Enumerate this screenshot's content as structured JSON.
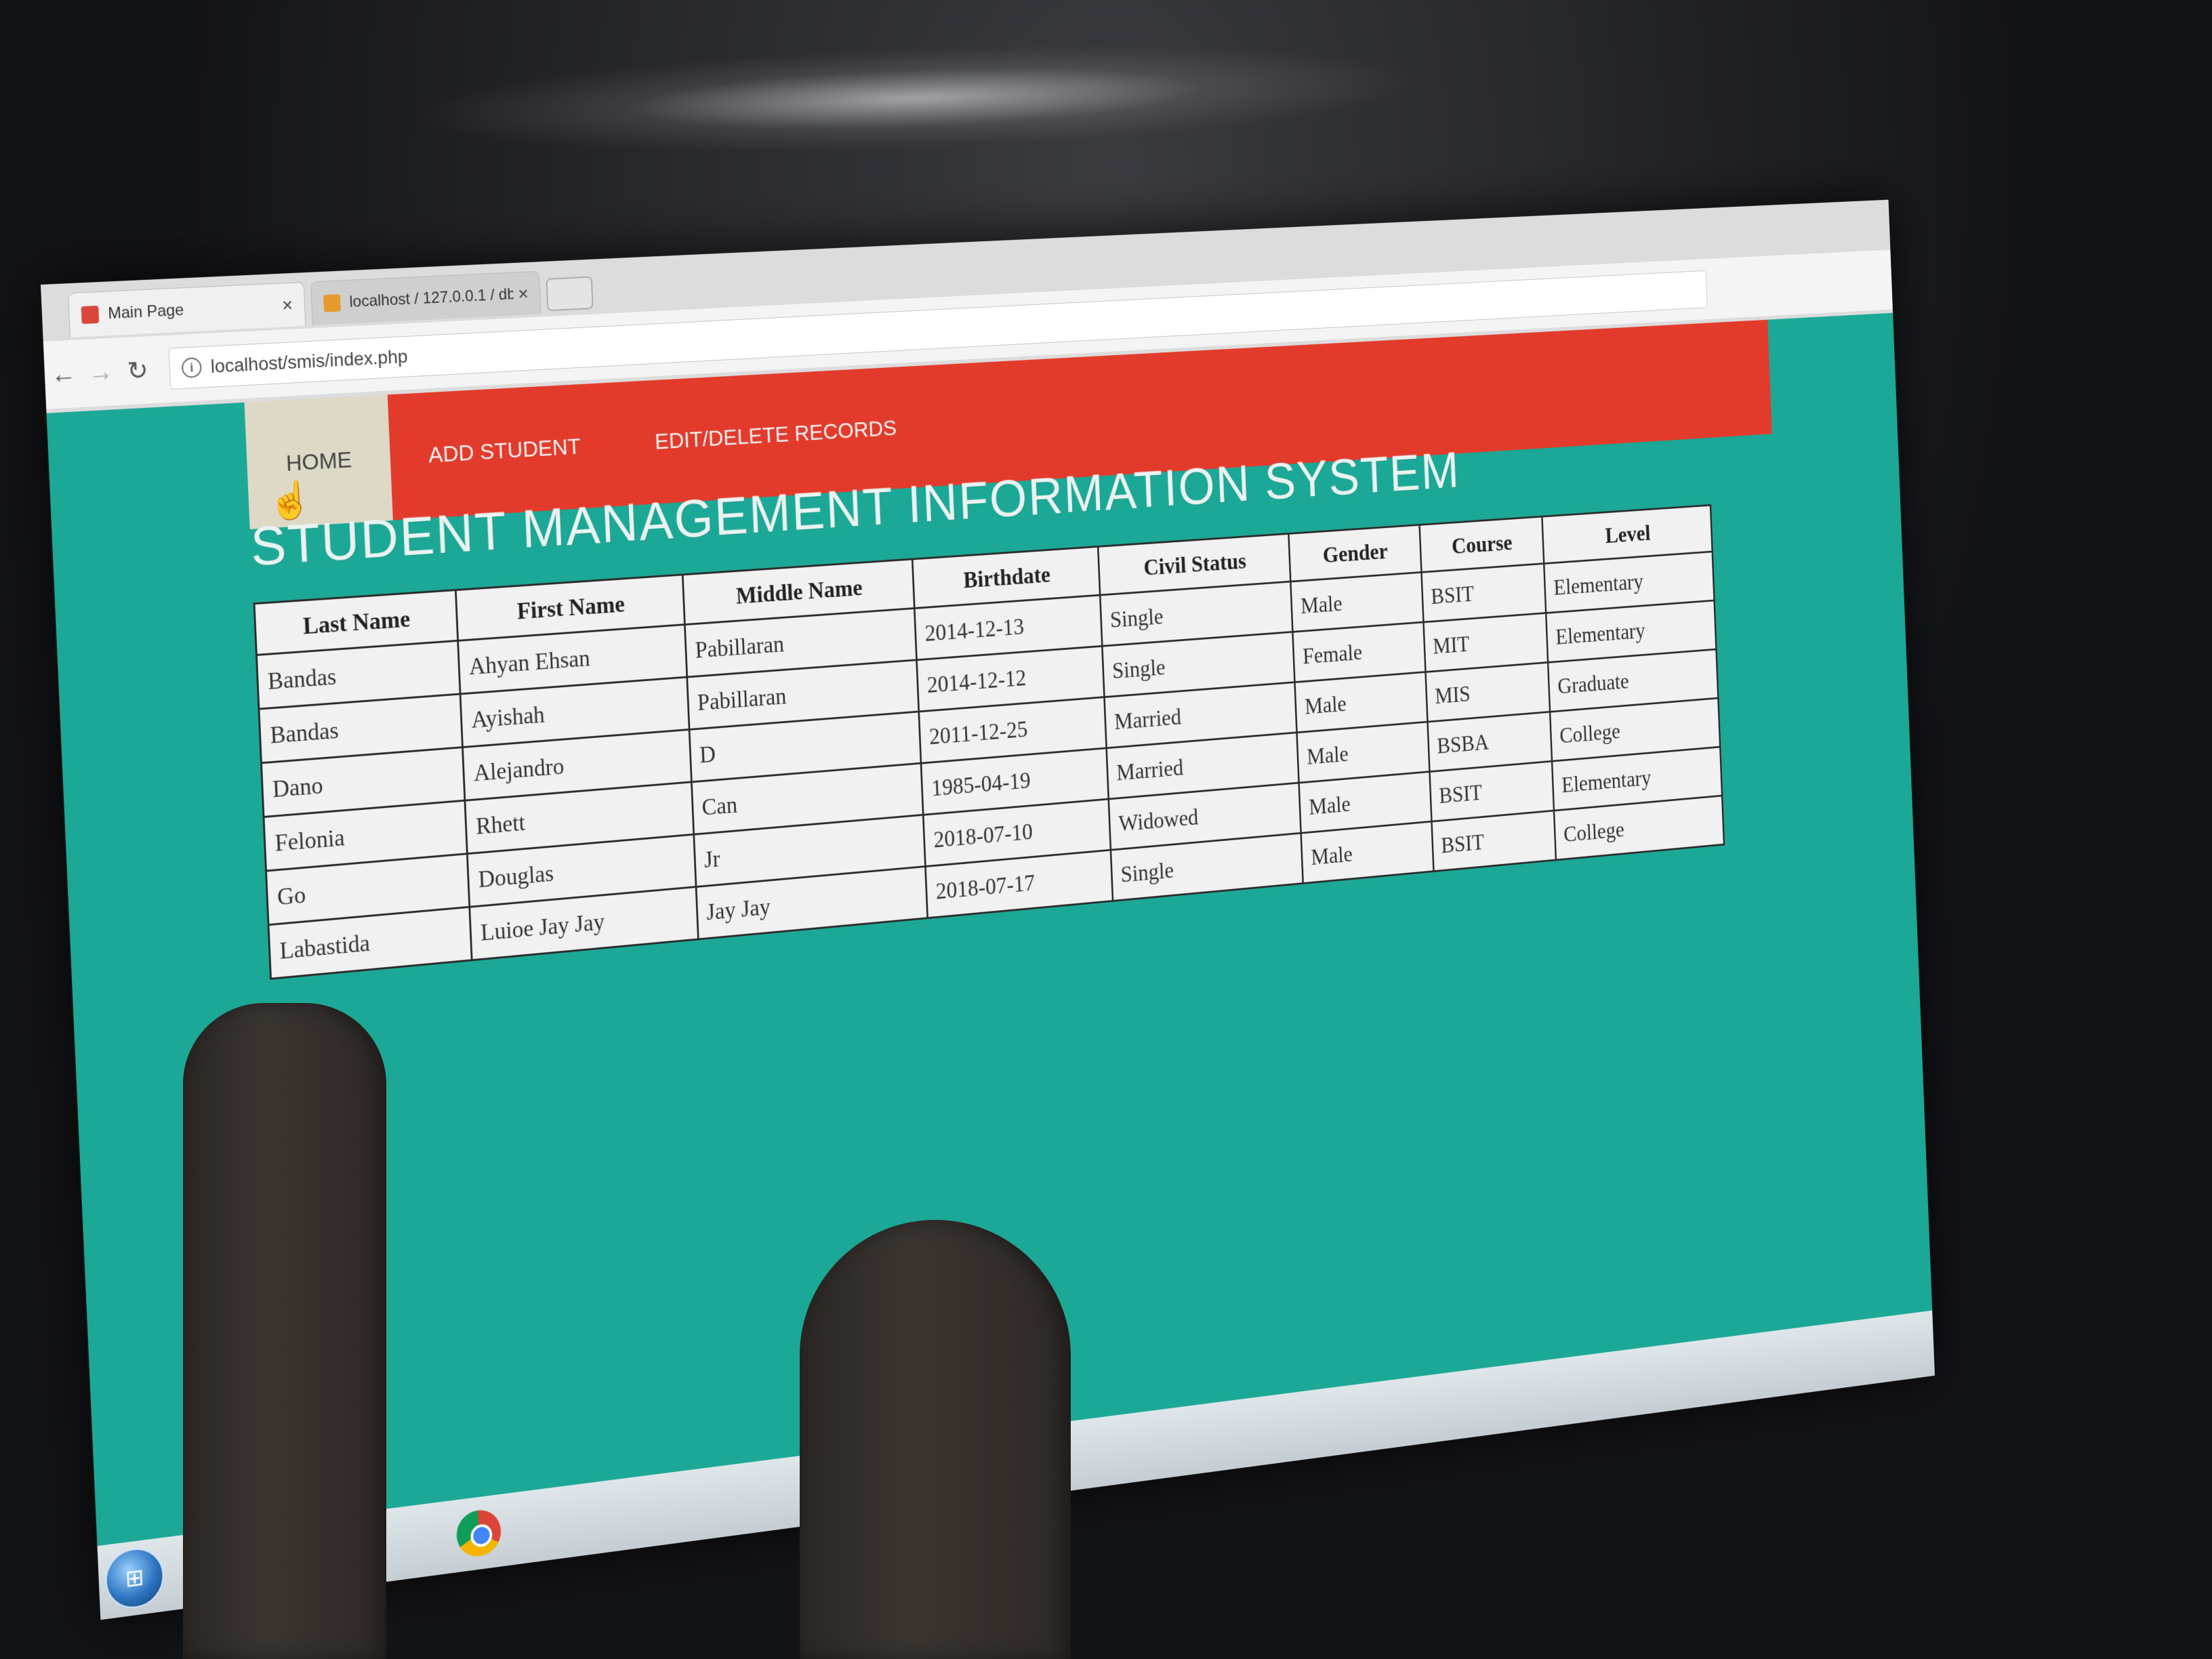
{
  "browser": {
    "tabs": [
      {
        "label": "Main Page",
        "close": "×"
      },
      {
        "label": "localhost / 127.0.0.1 / db",
        "close": "×"
      }
    ],
    "url": "localhost/smis/index.php"
  },
  "nav": {
    "menu": [
      {
        "label": "HOME"
      },
      {
        "label": "ADD STUDENT"
      },
      {
        "label": "EDIT/DELETE RECORDS"
      }
    ]
  },
  "page": {
    "title": "STUDENT MANAGEMENT INFORMATION SYSTEM"
  },
  "table": {
    "headers": [
      "Last Name",
      "First Name",
      "Middle Name",
      "Birthdate",
      "Civil Status",
      "Gender",
      "Course",
      "Level"
    ],
    "rows": [
      [
        "Bandas",
        "Ahyan Ehsan",
        "Pabillaran",
        "2014-12-13",
        "Single",
        "Male",
        "BSIT",
        "Elementary"
      ],
      [
        "Bandas",
        "Ayishah",
        "Pabillaran",
        "2014-12-12",
        "Single",
        "Female",
        "MIT",
        "Elementary"
      ],
      [
        "Dano",
        "Alejandro",
        "D",
        "2011-12-25",
        "Married",
        "Male",
        "MIS",
        "Graduate"
      ],
      [
        "Felonia",
        "Rhett",
        "Can",
        "1985-04-19",
        "Married",
        "Male",
        "BSBA",
        "College"
      ],
      [
        "Go",
        "Douglas",
        "Jr",
        "2018-07-10",
        "Widowed",
        "Male",
        "BSIT",
        "Elementary"
      ],
      [
        "Labastida",
        "Luioe Jay Jay",
        "Jay Jay",
        "2018-07-17",
        "Single",
        "Male",
        "BSIT",
        "College"
      ]
    ]
  },
  "colors": {
    "header_red": "#e23b2c",
    "page_teal": "#1ca896",
    "home_tab": "#ddd9c6"
  }
}
